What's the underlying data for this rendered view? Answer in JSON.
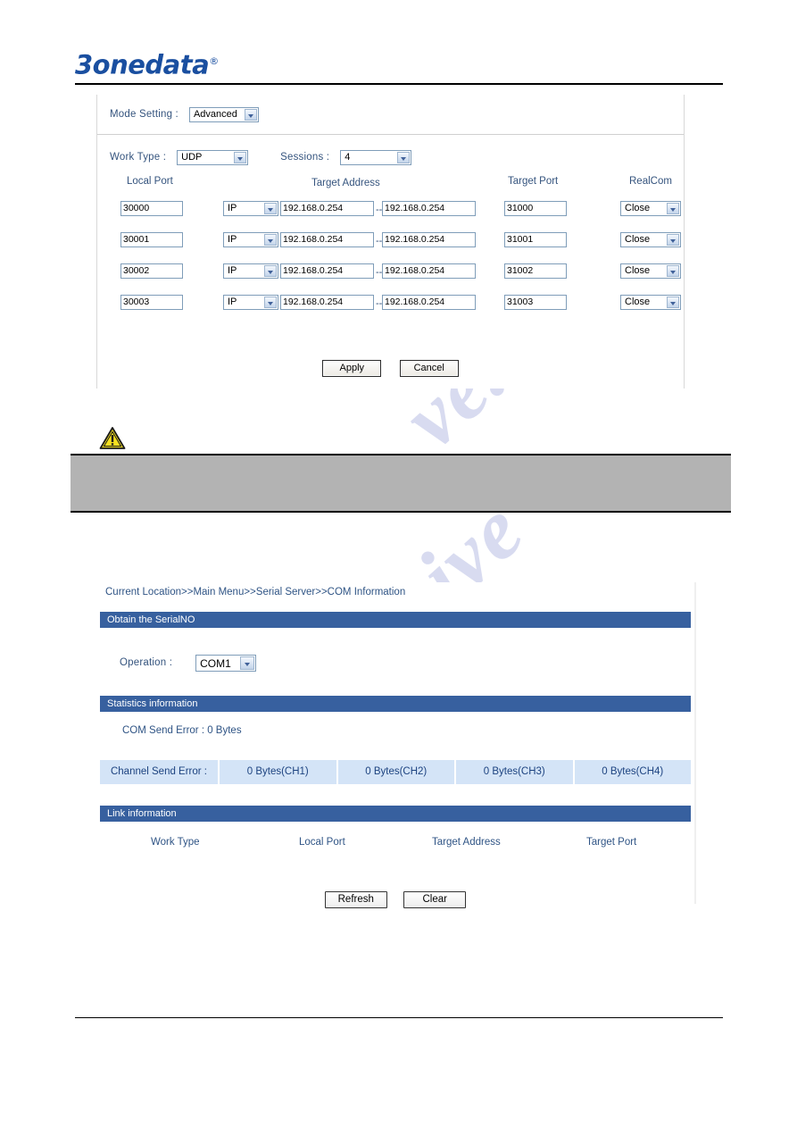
{
  "header": {
    "logo_text": "3onedata",
    "logo_registered": "®"
  },
  "figure_udp_settings": {
    "mode_setting_label": "Mode Setting :",
    "mode_setting_value": "Advanced",
    "work_type_label": "Work Type :",
    "work_type_value": "UDP",
    "sessions_label": "Sessions :",
    "sessions_value": "4",
    "columns": {
      "local_port": "Local Port",
      "target_address": "Target Address",
      "target_port": "Target Port",
      "realcom": "RealCom"
    },
    "range_separator": "--",
    "rows": [
      {
        "local_port": "30000",
        "addr_type": "IP",
        "target_address_start": "192.168.0.254",
        "target_address_end": "192.168.0.254",
        "target_port": "31000",
        "realcom": "Close"
      },
      {
        "local_port": "30001",
        "addr_type": "IP",
        "target_address_start": "192.168.0.254",
        "target_address_end": "192.168.0.254",
        "target_port": "31001",
        "realcom": "Close"
      },
      {
        "local_port": "30002",
        "addr_type": "IP",
        "target_address_start": "192.168.0.254",
        "target_address_end": "192.168.0.254",
        "target_port": "31002",
        "realcom": "Close"
      },
      {
        "local_port": "30003",
        "addr_type": "IP",
        "target_address_start": "192.168.0.254",
        "target_address_end": "192.168.0.254",
        "target_port": "31003",
        "realcom": "Close"
      }
    ],
    "apply_label": "Apply",
    "cancel_label": "Cancel"
  },
  "note": {
    "icon": "warning-triangle-icon",
    "text": ""
  },
  "figure_com_information": {
    "breadcrumb": "Current Location>>Main Menu>>Serial Server>>COM Information",
    "section_serial_title": "Obtain the SerialNO",
    "operation_label": "Operation :",
    "operation_value": "COM1",
    "section_statistics_title": "Statistics information",
    "com_send_error": "COM Send Error : 0 Bytes",
    "channel_send_error_label": "Channel Send Error :",
    "channel_values": [
      "0 Bytes(CH1)",
      "0 Bytes(CH2)",
      "0 Bytes(CH3)",
      "0 Bytes(CH4)"
    ],
    "section_link_title": "Link information",
    "link_columns": [
      "Work Type",
      "Local Port",
      "Target Address",
      "Target Port"
    ],
    "refresh_label": "Refresh",
    "clear_label": "Clear"
  },
  "watermark": {
    "line1": "ve.com",
    "line2": "manualshive"
  },
  "colors": {
    "brand_blue": "#1a4fa0",
    "section_bar": "#37609f",
    "channel_row": "#d4e4f7",
    "label_text": "#2f5485",
    "note_box": "#b3b3b3",
    "warning_yellow": "#f5e020"
  }
}
